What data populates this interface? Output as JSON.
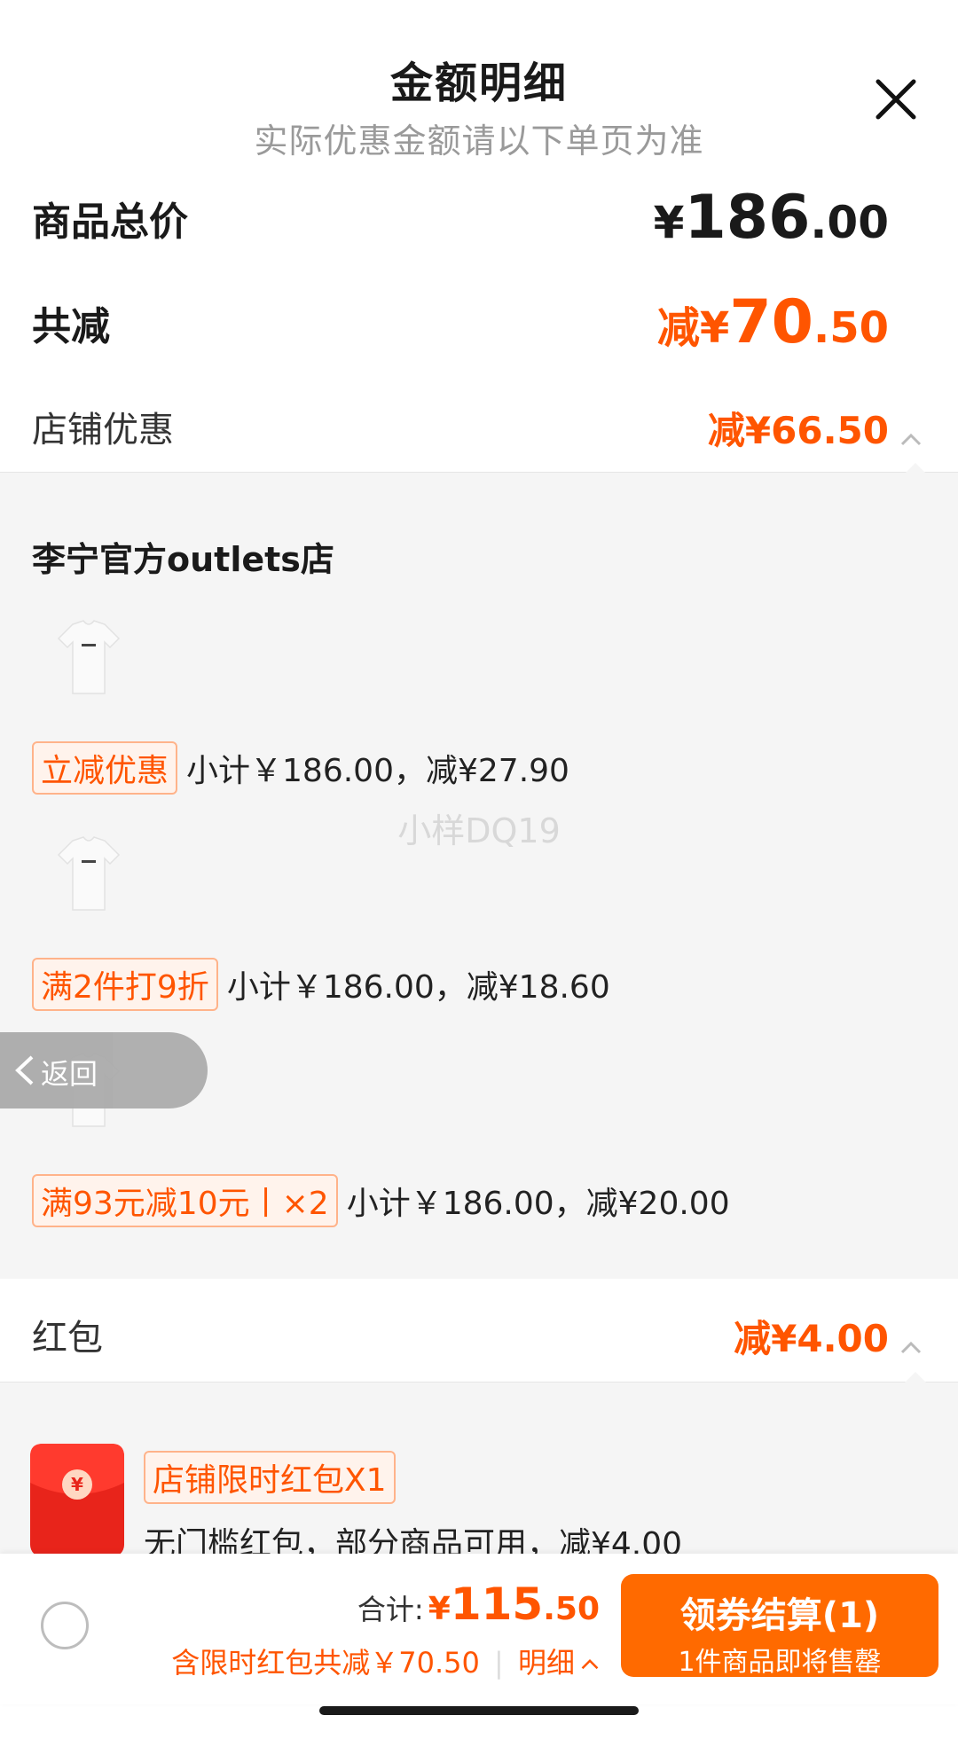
{
  "header": {
    "title": "金额明细",
    "subtitle": "实际优惠金额请以下单页为准"
  },
  "summary": {
    "total_label": "商品总价",
    "total_yen": "¥",
    "total_int": "186",
    "total_dec": ".00",
    "reduce_label": "共减",
    "reduce_prefix": "减¥",
    "reduce_int": "70",
    "reduce_dec": ".50"
  },
  "shop_discount": {
    "label": "店铺优惠",
    "prefix": "减¥",
    "int": "66",
    "dec": ".50"
  },
  "store": {
    "name": "李宁官方outlets店",
    "items": [
      {
        "tag": "立减优惠",
        "text": "小计￥186.00，减¥27.90"
      },
      {
        "tag": "满2件打9折",
        "text": "小计￥186.00，减¥18.60"
      },
      {
        "tag": "满93元减10元丨×2",
        "text": "小计￥186.00，减¥20.00"
      }
    ]
  },
  "watermark": "小样DQ19",
  "back_button": {
    "label": "返回"
  },
  "red_packet": {
    "label": "红包",
    "prefix": "减¥",
    "int": "4",
    "dec": ".00",
    "item_tag": "店铺限时红包X1",
    "item_desc": "无门槛红包，部分商品可用，减¥4.00"
  },
  "bottom": {
    "total_label": "合计:",
    "total_yen": "¥",
    "total_int": "115",
    "total_dec": ".50",
    "note": "含限时红包共减￥70.50",
    "detail_label": "明细",
    "checkout_label": "领券结算(1)",
    "checkout_sub": "1件商品即将售罄"
  },
  "colors": {
    "accent": "#ff5500",
    "button": "#ff6a00"
  }
}
